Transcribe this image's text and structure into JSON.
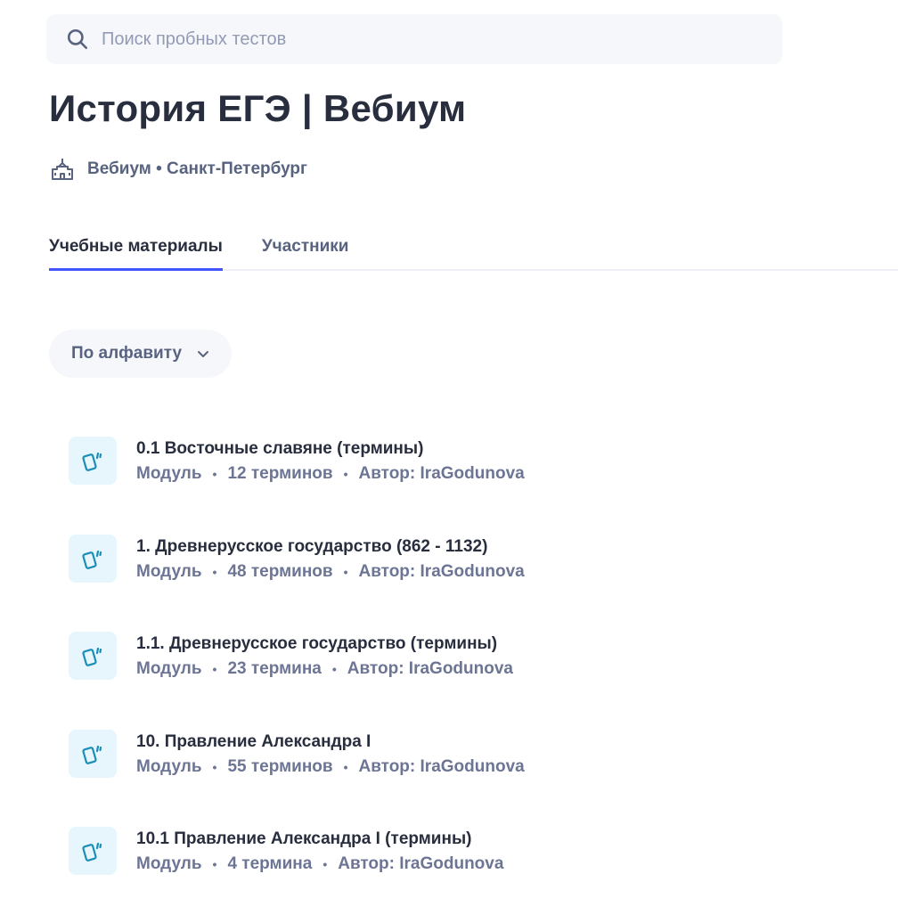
{
  "search": {
    "placeholder": "Поиск пробных тестов"
  },
  "page": {
    "title": "История ЕГЭ | Вебиум",
    "organization": "Вебиум • Санкт-Петербург"
  },
  "tabs": [
    {
      "label": "Учебные материалы",
      "active": true
    },
    {
      "label": "Участники",
      "active": false
    }
  ],
  "sort": {
    "label": "По алфавиту"
  },
  "items": [
    {
      "title": "0.1 Восточные славяне (термины)",
      "type": "Модуль",
      "count": "12 терминов",
      "author": "Автор: IraGodunova"
    },
    {
      "title": "1. Древнерусское государство (862 - 1132)",
      "type": "Модуль",
      "count": "48 терминов",
      "author": "Автор: IraGodunova"
    },
    {
      "title": "1.1. Древнерусское государство (термины)",
      "type": "Модуль",
      "count": "23 термина",
      "author": "Автор: IraGodunova"
    },
    {
      "title": "10. Правление Александра I",
      "type": "Модуль",
      "count": "55 терминов",
      "author": "Автор: IraGodunova"
    },
    {
      "title": "10.1 Правление Александра I (термины)",
      "type": "Модуль",
      "count": "4 термина",
      "author": "Автор: IraGodunova"
    }
  ],
  "colors": {
    "accent": "#4255ff",
    "icon_bg": "#e7f6fc",
    "icon_fg": "#1a8eb7"
  },
  "icons": {
    "search": "search-icon",
    "org": "school-building-icon",
    "sort": "chevron-down-icon",
    "item": "flashcards-icon"
  }
}
